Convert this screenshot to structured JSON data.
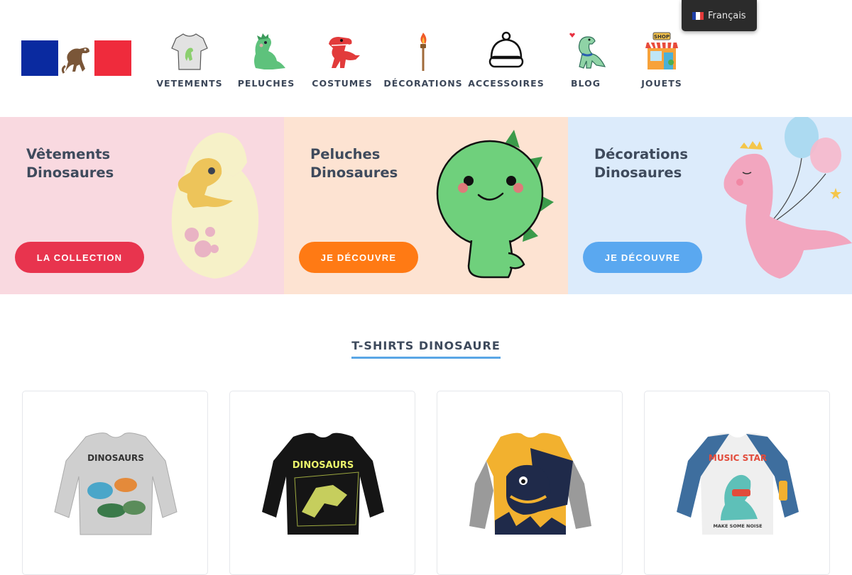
{
  "header": {
    "logo_alt": "",
    "nav": [
      {
        "label": "VETEMENTS",
        "icon": "tshirt-dino-icon"
      },
      {
        "label": "PELUCHES",
        "icon": "plush-dino-icon"
      },
      {
        "label": "COSTUMES",
        "icon": "red-dino-costume-icon"
      },
      {
        "label": "DÉCORATIONS",
        "icon": "torch-icon"
      },
      {
        "label": "ACCESSOIRES",
        "icon": "beanie-icon"
      },
      {
        "label": "BLOG",
        "icon": "dino-heart-icon"
      },
      {
        "label": "JOUETS",
        "icon": "toy-shop-icon"
      }
    ],
    "language": "Français"
  },
  "banners": [
    {
      "title_line1": "Vêtements",
      "title_line2": "Dinosaures",
      "cta": "LA COLLECTION",
      "bg": "#f9d9e0",
      "cta_color": "#e8344e"
    },
    {
      "title_line1": "Peluches",
      "title_line2": "Dinosaures",
      "cta": "JE DÉCOUVRE",
      "bg": "#fde3d2",
      "cta_color": "#ff7a14"
    },
    {
      "title_line1": "Décorations",
      "title_line2": "Dinosaures",
      "cta": "JE DÉCOUVRE",
      "bg": "#dcebfb",
      "cta_color": "#5aa8f0"
    }
  ],
  "section": {
    "title": "T-SHIRTS DINOSAURE",
    "underline_color": "#5aa6e6"
  },
  "products": [
    {
      "print_text": "DINOSAURS",
      "shirt_color": "#cfcfcf"
    },
    {
      "print_text": "DINOSAURS",
      "shirt_color": "#151515"
    },
    {
      "print_text": "",
      "shirt_color": "#f2b12f"
    },
    {
      "print_text": "MUSIC STAR",
      "print_subtext": "MAKE SOME NOISE",
      "shirt_color": "#3e6e9e"
    }
  ]
}
